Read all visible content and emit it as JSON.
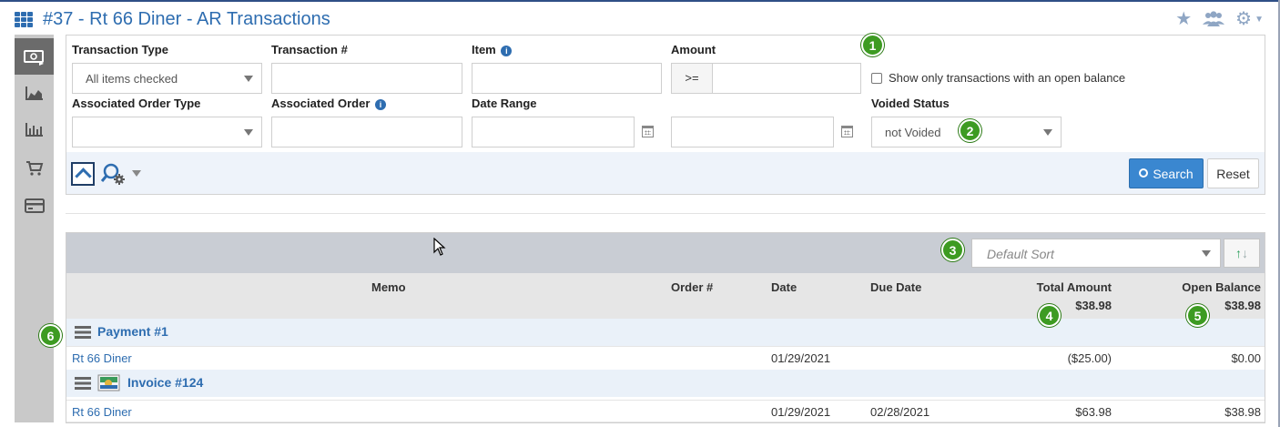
{
  "header": {
    "title": "#37 - Rt 66 Diner - AR Transactions",
    "icons": [
      "apps-grid-icon",
      "star-icon",
      "users-icon",
      "gear-icon"
    ]
  },
  "rail": {
    "items": [
      "cash-register-icon",
      "area-chart-icon",
      "bar-chart-icon",
      "cart-icon",
      "credit-card-icon"
    ],
    "active_index": 0
  },
  "filters": {
    "transaction_type": {
      "label": "Transaction Type",
      "value": "All items checked"
    },
    "transaction_number": {
      "label": "Transaction #",
      "value": ""
    },
    "item": {
      "label": "Item",
      "value": ""
    },
    "amount": {
      "label": "Amount",
      "operator": ">=",
      "value": ""
    },
    "open_balance_only": {
      "label": "Show only transactions with an open balance",
      "checked": false
    },
    "associated_order_type": {
      "label": "Associated Order Type",
      "value": ""
    },
    "associated_order": {
      "label": "Associated Order",
      "value": ""
    },
    "date_range": {
      "label": "Date Range",
      "from": "",
      "to": ""
    },
    "voided_status": {
      "label": "Voided Status",
      "value": "not Voided"
    },
    "search_label": "Search",
    "reset_label": "Reset"
  },
  "results": {
    "sort": {
      "value": "Default Sort"
    },
    "columns": {
      "memo": "Memo",
      "order": "Order #",
      "date": "Date",
      "due_date": "Due Date",
      "total_amount": "Total Amount",
      "open_balance": "Open Balance"
    },
    "totals": {
      "total_amount": "$38.98",
      "open_balance": "$38.98"
    },
    "groups": [
      {
        "title": "Payment #1",
        "customer": "Rt 66 Diner",
        "date": "01/29/2021",
        "due_date": "",
        "total_amount": "($25.00)",
        "open_balance": "$0.00"
      },
      {
        "title": "Invoice #124",
        "customer": "Rt 66 Diner",
        "date": "01/29/2021",
        "due_date": "02/28/2021",
        "total_amount": "$63.98",
        "open_balance": "$38.98"
      }
    ]
  },
  "callouts": [
    "1",
    "2",
    "3",
    "4",
    "5",
    "6"
  ],
  "colors": {
    "accent": "#2e6db0",
    "callout": "#3d9b22",
    "search_button": "#3a87d0"
  }
}
